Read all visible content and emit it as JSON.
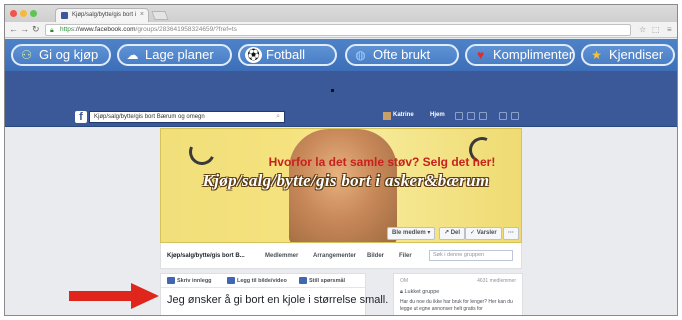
{
  "browser": {
    "tab_title": "Kjøp/salg/bytte/gis bort i",
    "url_scheme": "https",
    "url_host": "://www.facebook.com",
    "url_path": "/groups/283641958324659/?fref=ts"
  },
  "bookmarks": [
    {
      "label": "Gi og kjøp",
      "icon": "people-icon"
    },
    {
      "label": "Lage planer",
      "icon": "cloud-icon"
    },
    {
      "label": "Fotball",
      "icon": "soccer-ball-icon"
    },
    {
      "label": "Ofte brukt",
      "icon": "globe-icon"
    },
    {
      "label": "Komplimenter",
      "icon": "heart-icon"
    },
    {
      "label": "Kjendiser",
      "icon": "star-icon"
    }
  ],
  "facebook": {
    "search_value": "Kjøp/salg/bytte/gis bort Bærum og omegn",
    "user_name": "Katrine",
    "home_label": "Hjem"
  },
  "cover": {
    "red_line": "Hvorfor la det samle støv? Selg det her!",
    "main_line": "Kjøp/salg/bytte/gis bort i asker&bærum",
    "member_button": "Ble medlem ▾",
    "share_button": "Del",
    "notify_button": "Varsler",
    "more_button": "···"
  },
  "group_nav": {
    "items": [
      "Kjøp/salg/bytte/gis bort B...",
      "Medlemmer",
      "Arrangementer",
      "Bilder",
      "Filer"
    ],
    "search_placeholder": "Søk i denne gruppen"
  },
  "composer": {
    "tabs": [
      "Skriv innlegg",
      "Legg til bilde/video",
      "Still spørsmål"
    ],
    "text": "Jeg ønsker å gi bort en kjole i størrelse small."
  },
  "right_panel": {
    "heading": "OM",
    "members": "4631 medlemmer",
    "privacy": "Lukket gruppe",
    "description": "Har du noe du ikke har bruk for lenger? Her kan du legge ut egne annonser helt gratis for"
  },
  "colors": {
    "facebook_blue": "#3b5998",
    "bookmark_blue": "#4a7ec6",
    "cover_yellow": "#f3e07c",
    "arrow_red": "#e0261c"
  }
}
